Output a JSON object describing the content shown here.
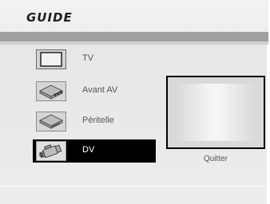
{
  "header": {
    "title": "GUIDE"
  },
  "menu": {
    "items": [
      {
        "label": "TV",
        "icon": "tv-icon"
      },
      {
        "label": "Avant AV",
        "icon": "av-front-icon"
      },
      {
        "label": "Péritelle",
        "icon": "scart-icon"
      },
      {
        "label": "DV",
        "icon": "dv-camera-icon",
        "selected": true
      }
    ]
  },
  "preview": {
    "quit_label": "Quitter"
  },
  "colors": {
    "selected_bg": "#000000",
    "bar": "#a0a0a0",
    "background": "#e8e8e8"
  }
}
